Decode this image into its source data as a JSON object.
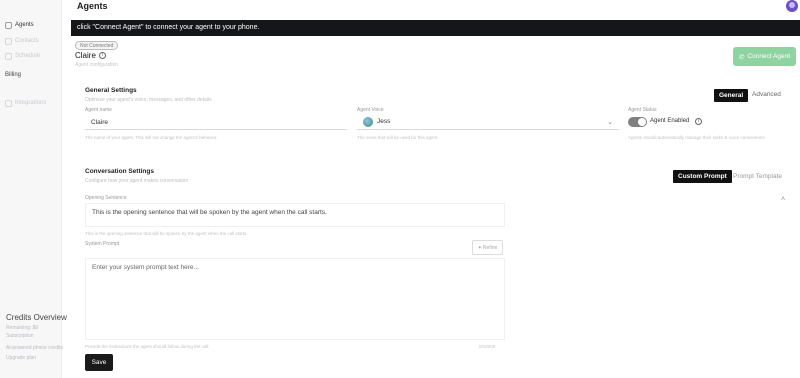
{
  "header": {
    "title": "Agents"
  },
  "sidebar": {
    "items": [
      {
        "label": "Agents",
        "icon": "home-icon"
      },
      {
        "label": "Contacts",
        "icon": "book-icon"
      },
      {
        "label": "Schedule",
        "icon": "calendar-icon"
      },
      {
        "label": "Billing",
        "icon": ""
      },
      {
        "label": "Integrations",
        "icon": "plug-icon"
      }
    ],
    "credits": {
      "title": "Credits Overview",
      "line1": "Remaining: $0",
      "line2": "Subscription",
      "line3": "AI-powered phone credits",
      "upgrade": "Upgrade plan"
    }
  },
  "banner": {
    "text": "click \"Connect Agent\" to connect your agent to your phone."
  },
  "agent": {
    "status": "Not Connected",
    "name": "Claire",
    "subtitle": "Agent configuration",
    "connect_label": "Connect Agent"
  },
  "general": {
    "title": "General Settings",
    "subtitle": "Optimize your agent's voice, messages, and other details",
    "tabs": [
      "General",
      "Advanced"
    ],
    "agent_name_label": "Agent name",
    "agent_name_value": "Claire",
    "agent_name_help": "The name of your agent. This will not change the agent's behavior.",
    "voice_label": "Agent Voice",
    "voice_value": "Jess",
    "voice_help": "The voice that will be used for this agent.",
    "status_label": "Agent Status",
    "status_value": "Agent Enabled",
    "status_help": "Agents should automatically manage their tasks & voice connections."
  },
  "conversation": {
    "title": "Conversation Settings",
    "subtitle": "Configure how your agent makes conversation",
    "tabs": [
      "Custom Prompt",
      "Prompt Template"
    ],
    "opening_label": "Opening Sentence",
    "opening_value": "This is the opening sentence that will be spoken by the agent when the call starts.",
    "opening_help": "This is the opening sentence that will be spoken by the agent when the call starts.",
    "system_label": "System Prompt",
    "refine_label": "Refine",
    "system_placeholder": "Enter your system prompt text here...",
    "system_help": "Provide the instructions the agent should follow during the call.",
    "char_count": "0/10000"
  },
  "actions": {
    "save_label": "Save"
  },
  "colors": {
    "accent": "#8fd3a1",
    "banner": "#15161a",
    "avatar": "#6a4fc8"
  }
}
